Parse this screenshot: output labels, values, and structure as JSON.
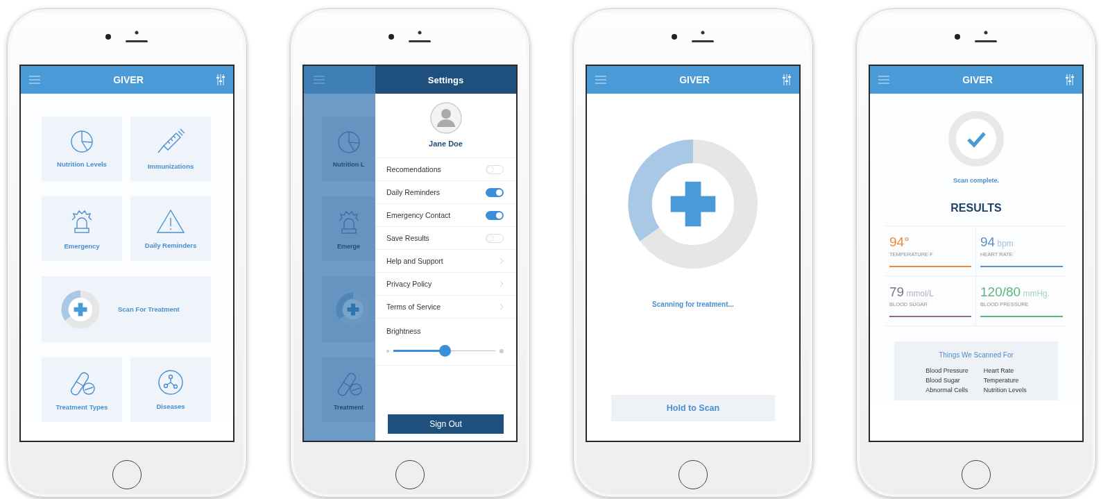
{
  "phones": [
    {
      "kind": "home",
      "header": {
        "title": "GIVER"
      },
      "tiles": [
        {
          "kind": "pie",
          "label": "Nutrition Levels"
        },
        {
          "kind": "syringe",
          "label": "Immunizations"
        },
        {
          "kind": "siren",
          "label": "Emergency"
        },
        {
          "kind": "warning",
          "label": "Daily Reminders"
        },
        {
          "kind": "scan",
          "label": "Scan For Treatment"
        },
        {
          "kind": "pill",
          "label": "Treatment Types"
        },
        {
          "kind": "molecule",
          "label": "Diseases"
        }
      ]
    },
    {
      "kind": "settings",
      "backdrop": {
        "tiles": [
          {
            "kind": "pie",
            "label": "Nutrition L"
          },
          {
            "kind": "siren",
            "label": "Emerge"
          },
          {
            "kind": "scan"
          },
          {
            "kind": "pill",
            "label": "Treatment"
          }
        ]
      },
      "drawer": {
        "title": "Settings",
        "user_name": "Jane Doe",
        "rows": [
          {
            "kind": "toggle",
            "label": "Recomendations",
            "on": false
          },
          {
            "kind": "toggle",
            "label": "Daily Reminders",
            "on": true
          },
          {
            "kind": "toggle",
            "label": "Emergency Contact",
            "on": true
          },
          {
            "kind": "toggle",
            "label": "Save Results",
            "on": false
          },
          {
            "kind": "link",
            "label": "Help and Support"
          },
          {
            "kind": "link",
            "label": "Privacy Policy"
          },
          {
            "kind": "link",
            "label": "Terms of Service"
          },
          {
            "kind": "slider",
            "label": "Brightness",
            "level": 0.5
          }
        ],
        "sign_out": "Sign Out"
      }
    },
    {
      "kind": "scan",
      "header": {
        "title": "GIVER"
      },
      "status": "Scanning for treatment...",
      "button": "Hold to Scan"
    },
    {
      "kind": "results",
      "header": {
        "title": "GIVER"
      },
      "status": "Scan complete.",
      "heading": "RESULTS",
      "metrics": [
        {
          "value": "94°",
          "label": "TEMPERATURE F",
          "color": "#f0883a"
        },
        {
          "value": "94",
          "unit": "bpm",
          "label": "HEART RATE",
          "color": "#5a8ec8"
        },
        {
          "value": "79",
          "unit": "mmol/L",
          "label": "BLOOD SUGAR",
          "color": "#8a6a8c"
        },
        {
          "value": "120/80",
          "unit": "mmHg.",
          "label": "BLOOD PRESSURE",
          "color": "#5cb57a"
        }
      ],
      "scanned": {
        "title": "Things We Scanned For",
        "items": [
          "Blood Pressure",
          "Heart Rate",
          "Blood Sugar",
          "Temperature",
          "Abnormal Cells",
          "Nutrition Levels"
        ]
      }
    }
  ]
}
